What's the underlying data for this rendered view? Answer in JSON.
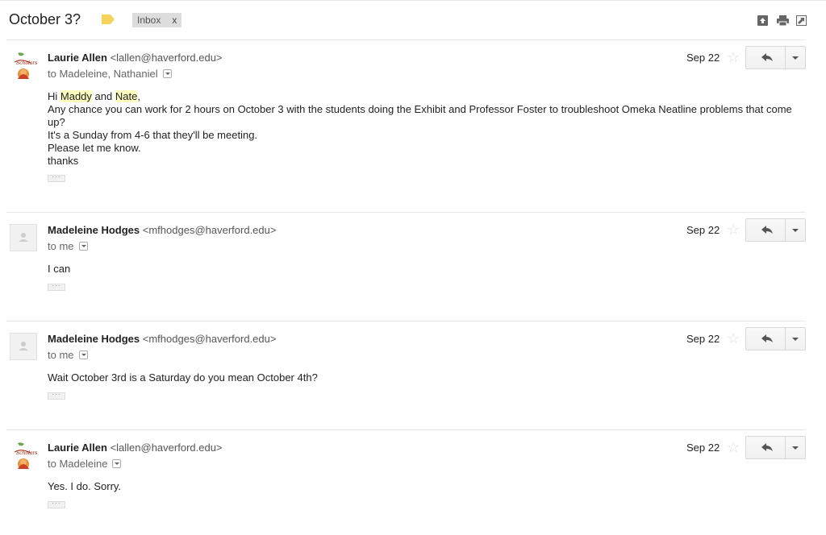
{
  "thread": {
    "subject": "October 3?",
    "label": {
      "name": "Inbox",
      "remove": "x"
    },
    "top_icons": [
      "archive-icon",
      "print-icon",
      "new-window-icon"
    ]
  },
  "messages": [
    {
      "sender_name": "Laurie Allen",
      "sender_email": "<lallen@haverford.edu>",
      "recipients": "to Madeleine, Nathaniel",
      "date": "Sep 22",
      "avatar": "scholarship-logo",
      "body": {
        "greeting_prefix": "Hi ",
        "name1": "Maddy",
        "and": " and ",
        "name2": "Nate",
        "comma": ",",
        "lines": [
          "Any chance you can work for 2 hours on October 3 with the students doing the Exhibit and Professor Foster to troubleshoot Omeka Neatline problems that come up?",
          "It's a Sunday from 4-6 that they'll be meeting.",
          "Please let me know.",
          "thanks"
        ]
      }
    },
    {
      "sender_name": "Madeleine Hodges",
      "sender_email": "<mfhodges@haverford.edu>",
      "recipients": "to me",
      "date": "Sep 22",
      "avatar": "generic-person",
      "body": {
        "lines": [
          "I can"
        ]
      }
    },
    {
      "sender_name": "Madeleine Hodges",
      "sender_email": "<mfhodges@haverford.edu>",
      "recipients": "to me",
      "date": "Sep 22",
      "avatar": "generic-person",
      "body": {
        "lines": [
          "Wait October 3rd is a Saturday do you mean October 4th?"
        ]
      }
    },
    {
      "sender_name": "Laurie Allen",
      "sender_email": "<lallen@haverford.edu>",
      "recipients": "to Madeleine",
      "date": "Sep 22",
      "avatar": "scholarship-logo",
      "body": {
        "lines": [
          "Yes. I do. Sorry."
        ]
      }
    }
  ],
  "colors": {
    "label_tag": "#f5d35a",
    "highlight": "#ffffbf",
    "divider": "#e5e5e5"
  }
}
